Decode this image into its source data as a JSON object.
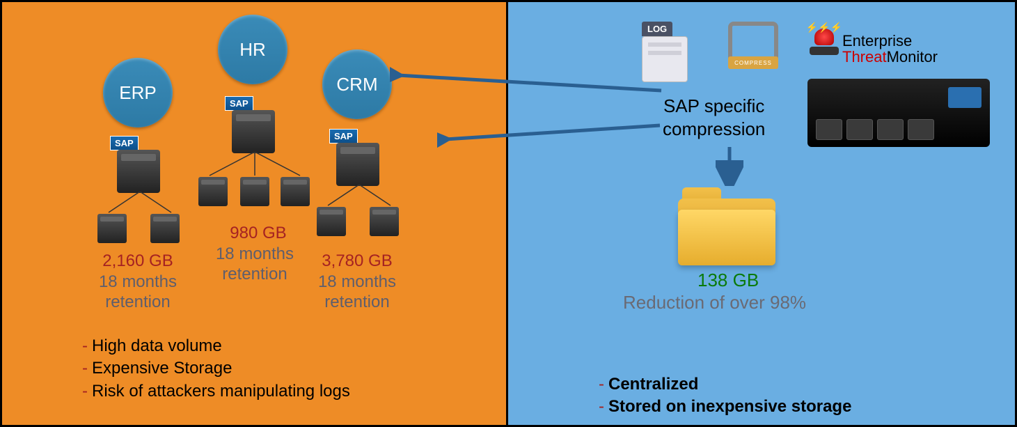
{
  "left": {
    "systems": [
      {
        "name": "ERP",
        "vendor": "SAP",
        "size": "2,160 GB",
        "retention": "18 months retention"
      },
      {
        "name": "HR",
        "vendor": "SAP",
        "size": "980 GB",
        "retention": "18 months retention"
      },
      {
        "name": "CRM",
        "vendor": "SAP",
        "size": "3,780 GB",
        "retention": "18 months retention"
      }
    ],
    "bullets": [
      "High data volume",
      "Expensive Storage",
      "Risk of attackers manipulating logs"
    ]
  },
  "right": {
    "log_label": "LOG",
    "compress_label": "COMPRESS",
    "brand": {
      "line1": "Enterprise",
      "line2a": "Threat",
      "line2b": "Monitor"
    },
    "compression_text": "SAP specific compression",
    "result_size": "138 GB",
    "result_text": "Reduction of over 98%",
    "bullets": [
      "Centralized",
      "Stored on inexpensive storage"
    ]
  },
  "icons": {
    "log": "log-file-icon",
    "compress": "compress-clamp-icon",
    "alarm": "red-alarm-light-icon",
    "folder": "folder-icon",
    "server": "server-rack-icon"
  },
  "colors": {
    "left_bg": "#ee8c26",
    "right_bg": "#6aaee2",
    "size_text": "#a52222",
    "retention_text": "#5e5e6d",
    "result_green": "#0a7a0a",
    "brand_red": "#c00000",
    "arrow": "#2a5f91"
  }
}
